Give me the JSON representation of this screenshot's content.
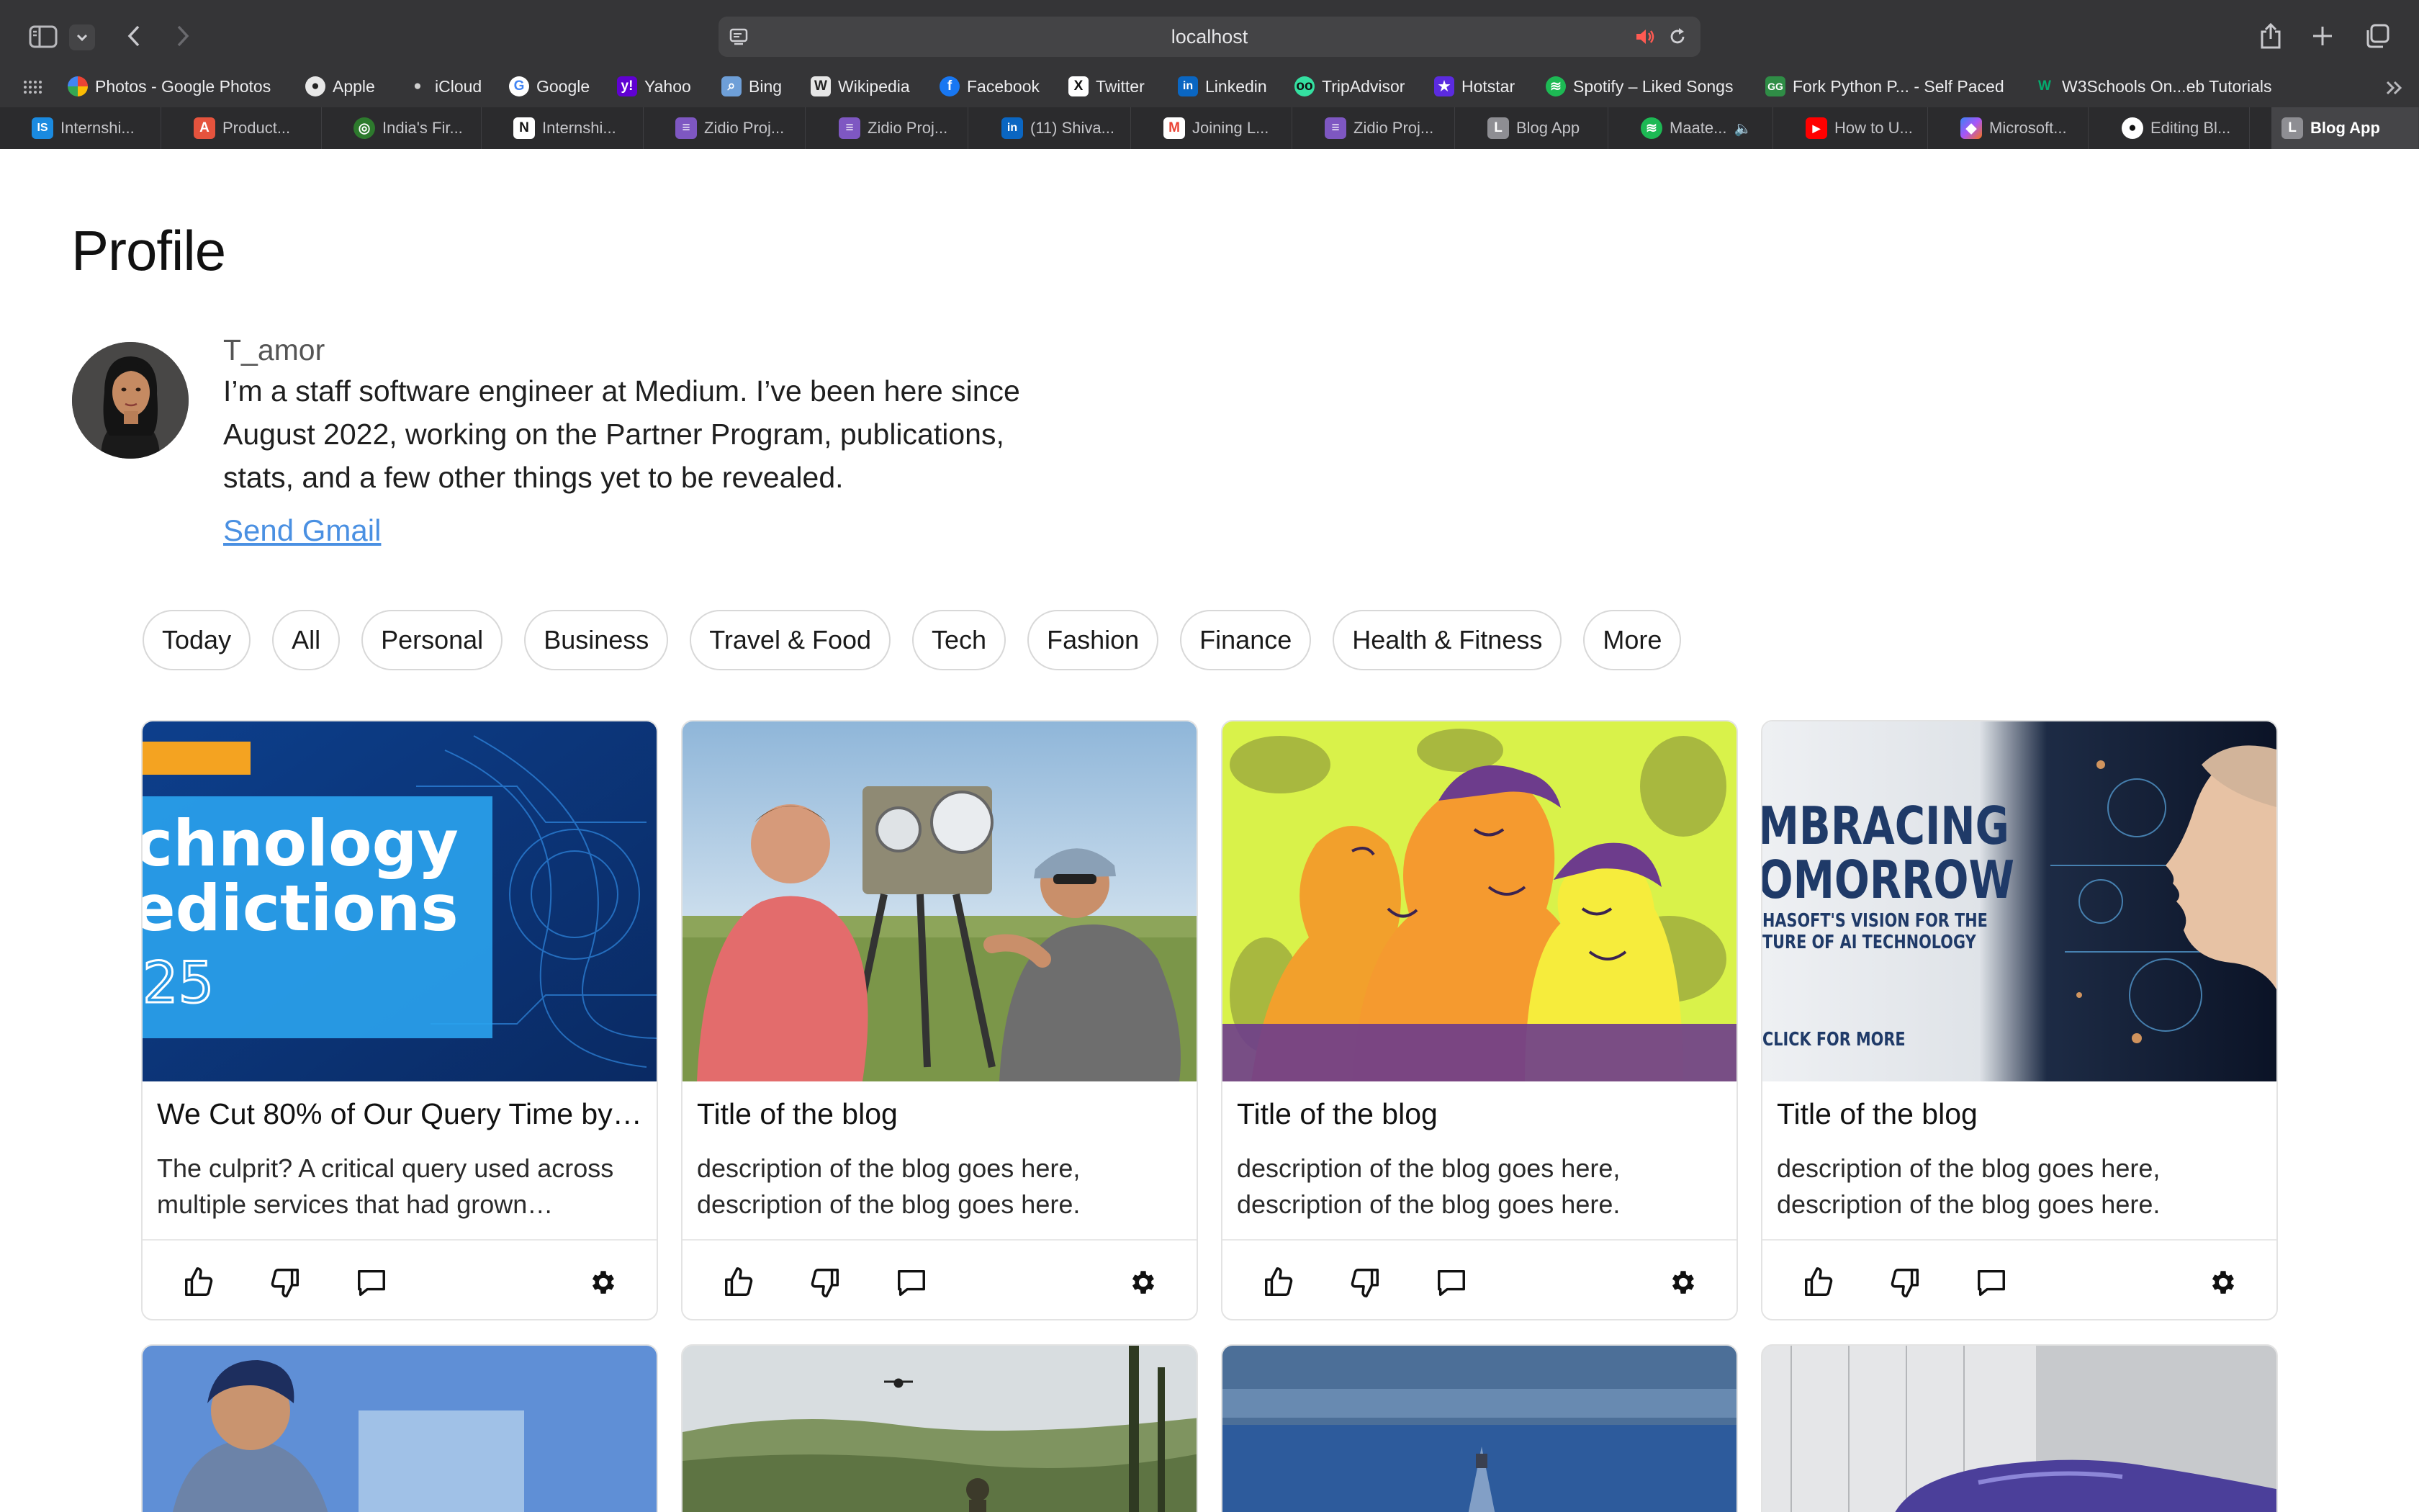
{
  "browser": {
    "address": "localhost",
    "favorites": [
      {
        "label": "Photos - Google Photos",
        "icon": "photos-icon",
        "color": "#ea4335"
      },
      {
        "label": "Apple",
        "icon": "apple-icon",
        "color": "#1c1c1c"
      },
      {
        "label": "iCloud",
        "icon": "apple-icon",
        "color": "#1c1c1c"
      },
      {
        "label": "Google",
        "icon": "google-icon",
        "color": "#4285f4"
      },
      {
        "label": "Yahoo",
        "icon": "yahoo-icon",
        "color": "#6001d2"
      },
      {
        "label": "Bing",
        "icon": "bing-icon",
        "color": "#6e9fd8"
      },
      {
        "label": "Wikipedia",
        "icon": "wikipedia-icon",
        "color": "#dddddd"
      },
      {
        "label": "Facebook",
        "icon": "facebook-icon",
        "color": "#1877f2"
      },
      {
        "label": "Twitter",
        "icon": "x-icon",
        "color": "#111111"
      },
      {
        "label": "Linkedin",
        "icon": "linkedin-icon",
        "color": "#0a66c2"
      },
      {
        "label": "TripAdvisor",
        "icon": "tripadvisor-icon",
        "color": "#34e0a1"
      },
      {
        "label": "Hotstar",
        "icon": "hotstar-icon",
        "color": "#5b2be0"
      },
      {
        "label": "Spotify – Liked Songs",
        "icon": "spotify-icon",
        "color": "#1db954"
      },
      {
        "label": "Fork Python P... - Self Paced",
        "icon": "gfg-icon",
        "color": "#2f8d46"
      },
      {
        "label": "W3Schools On...eb Tutorials",
        "icon": "w3schools-icon",
        "color": "#04aa6d"
      }
    ],
    "tabs": [
      {
        "label": "Internshi...",
        "icon": "internshala-icon",
        "color": "#1a8ae0",
        "glyph": "IS"
      },
      {
        "label": "Product...",
        "icon": "product-icon",
        "color": "#e5533d",
        "glyph": "A"
      },
      {
        "label": "India's Fir...",
        "icon": "india-icon",
        "color": "#2d7a2d",
        "glyph": "◎"
      },
      {
        "label": "Internshi...",
        "icon": "notion-icon",
        "color": "#ffffff",
        "glyph": "N"
      },
      {
        "label": "Zidio Proj...",
        "icon": "form-icon",
        "color": "#7e57c2",
        "glyph": "≡"
      },
      {
        "label": "Zidio Proj...",
        "icon": "form-icon",
        "color": "#7e57c2",
        "glyph": "≡"
      },
      {
        "label": "(11) Shiva...",
        "icon": "linkedin-icon",
        "color": "#0a66c2",
        "glyph": "in"
      },
      {
        "label": "Joining L...",
        "icon": "gmail-icon",
        "color": "#ea4335",
        "glyph": "M"
      },
      {
        "label": "Zidio Proj...",
        "icon": "form-icon",
        "color": "#7e57c2",
        "glyph": "≡"
      },
      {
        "label": "Blog App",
        "icon": "letter-l-icon",
        "color": "#8e8e93",
        "glyph": "L"
      },
      {
        "label": "Maate...",
        "icon": "spotify-icon",
        "color": "#1db954",
        "glyph": "♫"
      },
      {
        "label": "How to U...",
        "icon": "youtube-icon",
        "color": "#ff0000",
        "glyph": "▶"
      },
      {
        "label": "Microsoft...",
        "icon": "copilot-icon",
        "color": "#7a5af8",
        "glyph": "◆"
      },
      {
        "label": "Editing Bl...",
        "icon": "github-icon",
        "color": "#ffffff",
        "glyph": "●"
      },
      {
        "label": "Blog App",
        "icon": "letter-l-icon",
        "color": "#8e8e93",
        "glyph": "L"
      }
    ]
  },
  "profile": {
    "title": "Profile",
    "username": "T_amor",
    "bio": "I’m a staff software engineer at Medium. I’ve been here since August 2022, working on the Partner Program, publications, stats, and a few other things yet to be revealed.",
    "link": "Send Gmail"
  },
  "categories": [
    "Today",
    "All",
    "Personal",
    "Business",
    "Travel & Food",
    "Tech",
    "Fashion",
    "Finance",
    "Health & Fitness",
    "More"
  ],
  "posts": [
    {
      "title": "We Cut 80% of Our Query Time by …",
      "description": "The culprit? A critical query used across multiple services that had grown…",
      "image": "technology-predictions-banner",
      "image_text": [
        "chnology",
        "edictions",
        "25"
      ]
    },
    {
      "title": "Title of the blog",
      "description": "description of the blog goes here, description of the blog goes here.",
      "image": "two-men-with-instrument-photo"
    },
    {
      "title": "Title of the blog",
      "description": "description of the blog goes here, description of the blog goes here.",
      "image": "colorful-faces-illustration"
    },
    {
      "title": "Title of the blog",
      "description": "description of the blog goes here, description of the blog goes here.",
      "image": "ai-technology-banner",
      "image_text": [
        "MBRACING",
        "OMORROW",
        "HASOFT'S VISION FOR THE",
        "TURE OF AI TECHNOLOGY",
        "CLICK FOR MORE"
      ]
    }
  ],
  "second_row_images": [
    "officer-photo",
    "valley-drone-photo",
    "ocean-ship-photo",
    "purple-car-photo"
  ]
}
